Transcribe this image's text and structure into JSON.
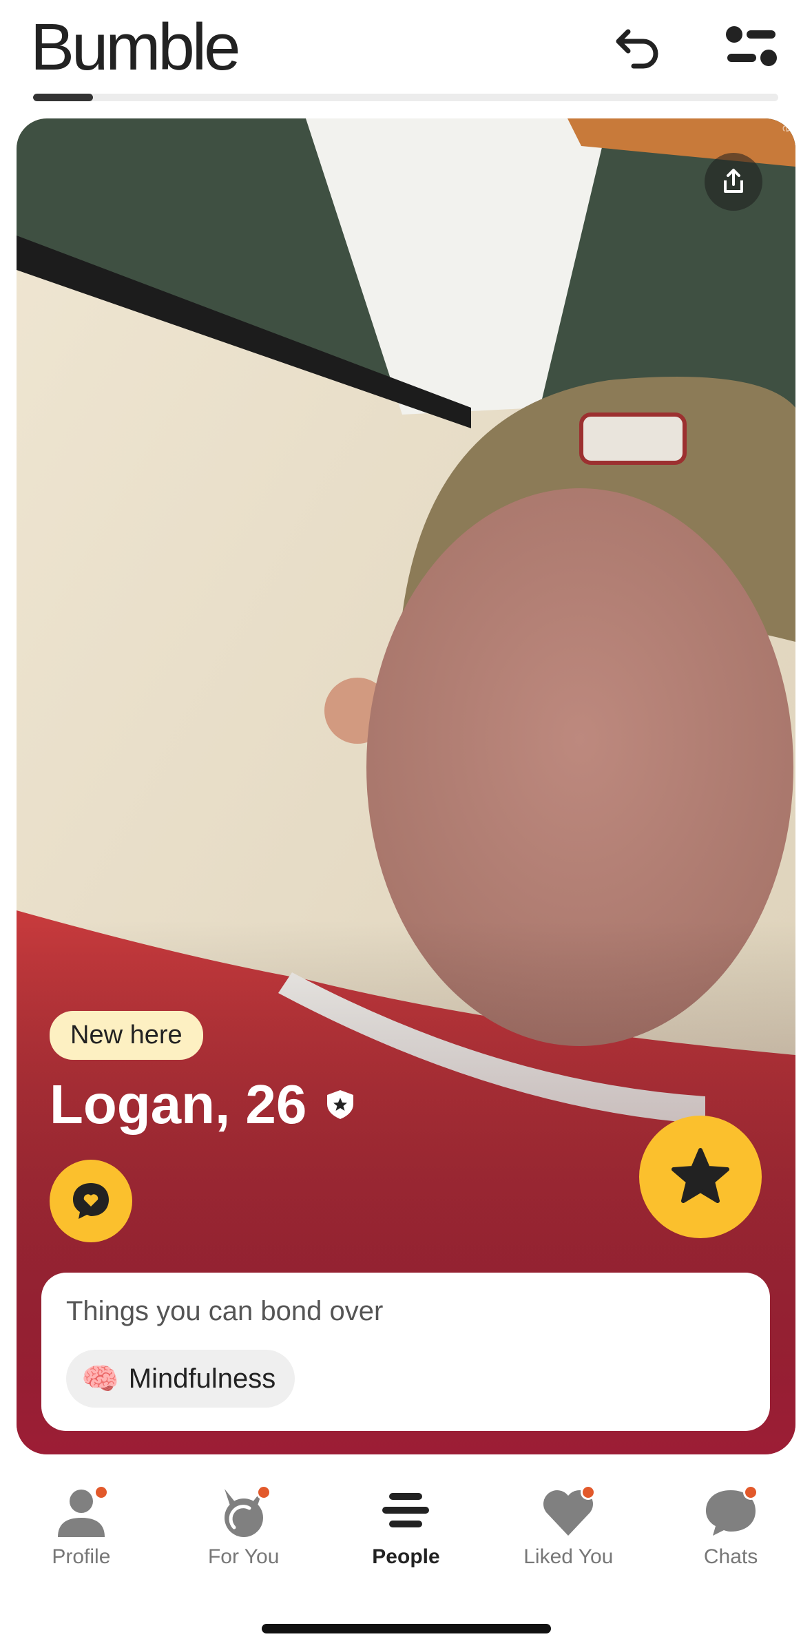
{
  "header": {
    "brand": "Bumble",
    "undo_icon": "undo-icon",
    "filter_icon": "filter-icon",
    "photo_progress": 0.08
  },
  "card": {
    "share_icon": "share-icon",
    "badge": "New here",
    "name": "Logan, 26",
    "verified_icon": "verified-shield-icon",
    "compliment_icon": "compliment-icon",
    "superswipe_icon": "star-icon",
    "bond": {
      "title": "Things you can bond over",
      "chip_emoji": "🧠",
      "chip_label": "Mindfulness"
    }
  },
  "nav": {
    "items": [
      {
        "label": "Profile",
        "icon": "person-icon",
        "dot": true,
        "active": false
      },
      {
        "label": "For You",
        "icon": "for-you-icon",
        "dot": true,
        "active": false
      },
      {
        "label": "People",
        "icon": "people-stack-icon",
        "dot": false,
        "active": true
      },
      {
        "label": "Liked You",
        "icon": "heart-icon",
        "dot": true,
        "active": false
      },
      {
        "label": "Chats",
        "icon": "chat-icon",
        "dot": true,
        "active": false
      }
    ]
  },
  "colors": {
    "accent": "#fbc02d",
    "notification": "#e2592b",
    "text_dark": "#222222"
  }
}
